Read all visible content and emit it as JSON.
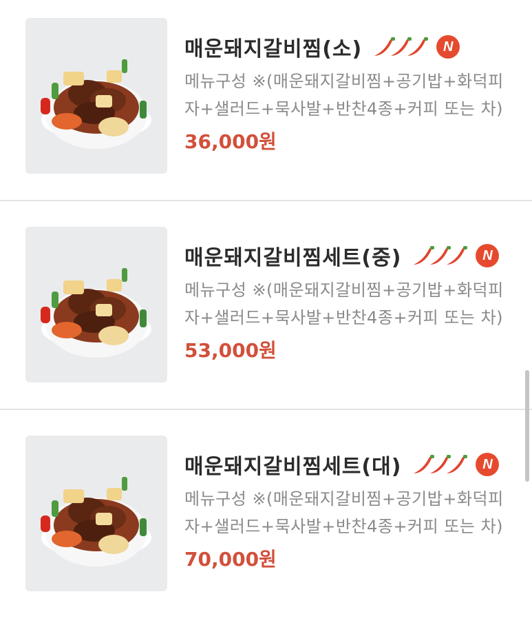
{
  "menu": {
    "items": [
      {
        "title": "매운돼지갈비찜(소)",
        "description": "메뉴구성 ※(매운돼지갈비찜+공기밥+화덕피자+샐러드+묵사발+반찬4종+커피 또는 차)",
        "price": "36,000원",
        "spicy_level": 3,
        "badge": "N"
      },
      {
        "title": "매운돼지갈비찜세트(중)",
        "description": "메뉴구성 ※(매운돼지갈비찜+공기밥+화덕피자+샐러드+묵사발+반찬4종+커피 또는 차)",
        "price": "53,000원",
        "spicy_level": 3,
        "badge": "N"
      },
      {
        "title": "매운돼지갈비찜세트(대)",
        "description": "메뉴구성 ※(매운돼지갈비찜+공기밥+화덕피자+샐러드+묵사발+반찬4종+커피 또는 차)",
        "price": "70,000원",
        "spicy_level": 3,
        "badge": "N"
      }
    ]
  },
  "colors": {
    "price": "#d2503b",
    "badge": "#e64a2e",
    "pepper": "#e0452f"
  },
  "icons": {
    "spicy": "chili-pepper-icon",
    "new": "new-badge-icon"
  }
}
